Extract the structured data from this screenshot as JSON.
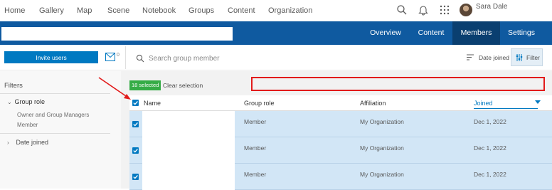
{
  "nav": {
    "items": [
      "Home",
      "Gallery",
      "Map",
      "Scene",
      "Notebook",
      "Groups",
      "Content",
      "Organization"
    ],
    "user_name": "Sara Dale"
  },
  "group_header": {
    "tabs": [
      "Overview",
      "Content",
      "Members",
      "Settings"
    ],
    "active_tab": "Members",
    "title": ""
  },
  "toolbar": {
    "invite_label": "Invite users",
    "mail_count": "0",
    "search_placeholder": "Search group member",
    "sort_label": "Date joined",
    "filter_label": "Filter"
  },
  "filters": {
    "title": "Filters",
    "group_role": {
      "label": "Group role",
      "options": [
        "Owner and Group Managers",
        "Member"
      ]
    },
    "date_joined": {
      "label": "Date joined"
    }
  },
  "selection": {
    "badge": "18 selected",
    "clear_label": "Clear selection"
  },
  "table": {
    "headers": {
      "name": "Name",
      "role": "Group role",
      "affiliation": "Affiliation",
      "joined": "Joined"
    },
    "rows": [
      {
        "role": "Member",
        "affiliation": "My Organization",
        "joined": "Dec 1, 2022"
      },
      {
        "role": "Member",
        "affiliation": "My Organization",
        "joined": "Dec 1, 2022"
      },
      {
        "role": "Member",
        "affiliation": "My Organization",
        "joined": "Dec 1, 2022"
      }
    ]
  },
  "colors": {
    "header_blue": "#0f5aa0",
    "active_tab": "#0a3f70",
    "accent": "#0079c1",
    "selected_badge": "#35ac46",
    "row_selected": "#d2e6f6",
    "annotation_red": "#e21b1b"
  }
}
